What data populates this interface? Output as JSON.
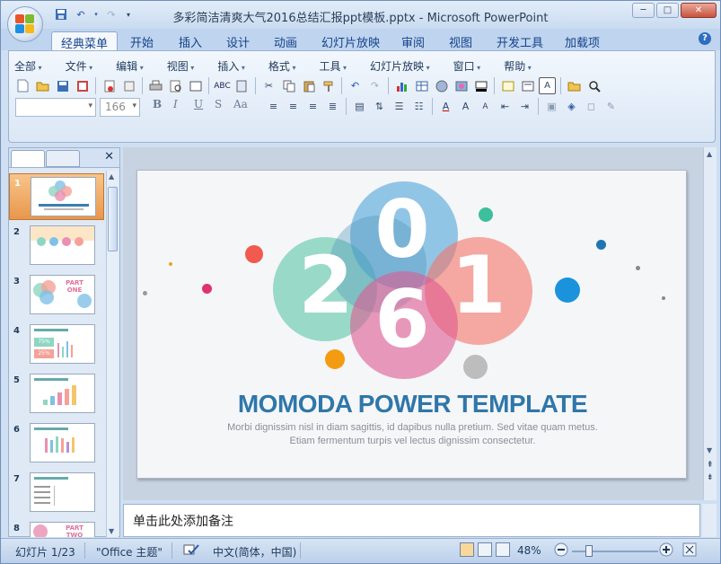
{
  "window": {
    "title": "多彩简洁清爽大气2016总结汇报ppt模板.pptx - Microsoft PowerPoint",
    "controls": {
      "minimize": "─",
      "maximize": "□",
      "close": "✕"
    }
  },
  "ribbon_tabs": [
    "经典菜单",
    "开始",
    "插入",
    "设计",
    "动画",
    "幻灯片放映",
    "审阅",
    "视图",
    "开发工具",
    "加载项"
  ],
  "classic_menu": [
    "全部",
    "文件",
    "编辑",
    "视图",
    "插入",
    "格式",
    "工具",
    "幻灯片放映",
    "窗口",
    "帮助"
  ],
  "font_box": {
    "family": "",
    "size": "166"
  },
  "format_buttons": [
    "B",
    "I",
    "U",
    "S",
    "Aa"
  ],
  "thumbnails": {
    "numbers": [
      "1",
      "2",
      "3",
      "4",
      "5",
      "6",
      "7",
      "8"
    ],
    "slide1_digits": "2061",
    "slide3_title": "PART ONE",
    "slide4_pcts": [
      "75%",
      "25%"
    ],
    "slide8_title": "PART TWO"
  },
  "slide": {
    "digits": {
      "two": "2",
      "zero": "0",
      "six": "6",
      "one": "1"
    },
    "headline": "MOMODA POWER TEMPLATE",
    "sub1": "Morbi dignissim nisl in diam sagittis, id dapibus nulla pretium. Sed vitae quam metus.",
    "sub2": "Etiam fermentum turpis vel lectus dignissim consectetur."
  },
  "notes_placeholder": "单击此处添加备注",
  "status": {
    "slide_info": "幻灯片 1/23",
    "theme": "\"Office 主题\"",
    "language": "中文(简体，中国)",
    "zoom": "48%"
  },
  "colors": {
    "teal": "#7fd0bb",
    "blue": "#6bb4df",
    "pink": "#e57fa8",
    "salmon": "#f58c80",
    "headline": "#2f77a9",
    "ribbon_bg": "#dbe7f5"
  }
}
